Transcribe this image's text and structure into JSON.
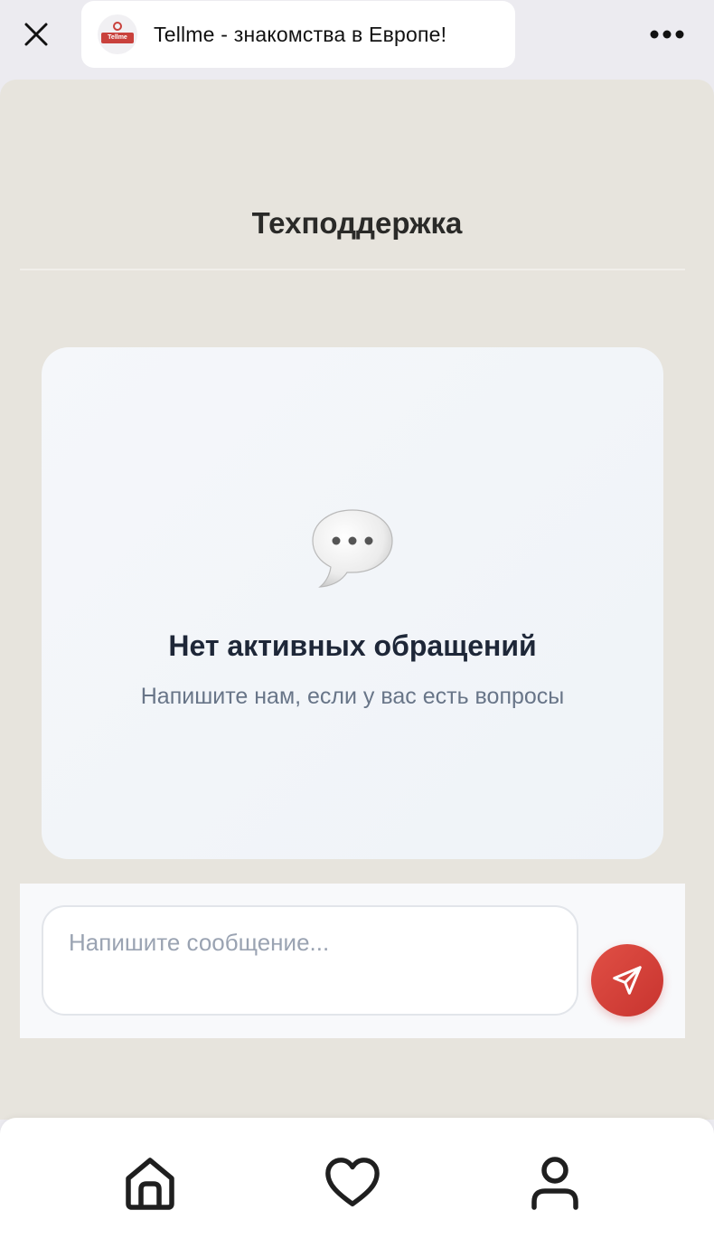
{
  "browser": {
    "app_title": "Tellme - знакомства в Европе!",
    "logo_text": "Tellme"
  },
  "page": {
    "title": "Техподдержка"
  },
  "empty_state": {
    "title": "Нет активных обращений",
    "subtitle": "Напишите нам, если у вас есть вопросы"
  },
  "composer": {
    "placeholder": "Напишите сообщение...",
    "value": ""
  },
  "icons": {
    "close": "close-icon",
    "more": "more-dots-icon",
    "chat": "speech-bubble-icon",
    "send": "send-icon",
    "home": "home-icon",
    "likes": "heart-icon",
    "profile": "user-icon"
  },
  "colors": {
    "accent": "#d63f39",
    "content_bg": "#e7e4dd",
    "card_bg": "#f3f6fa",
    "title_text": "#1e2738",
    "muted_text": "#687588"
  }
}
